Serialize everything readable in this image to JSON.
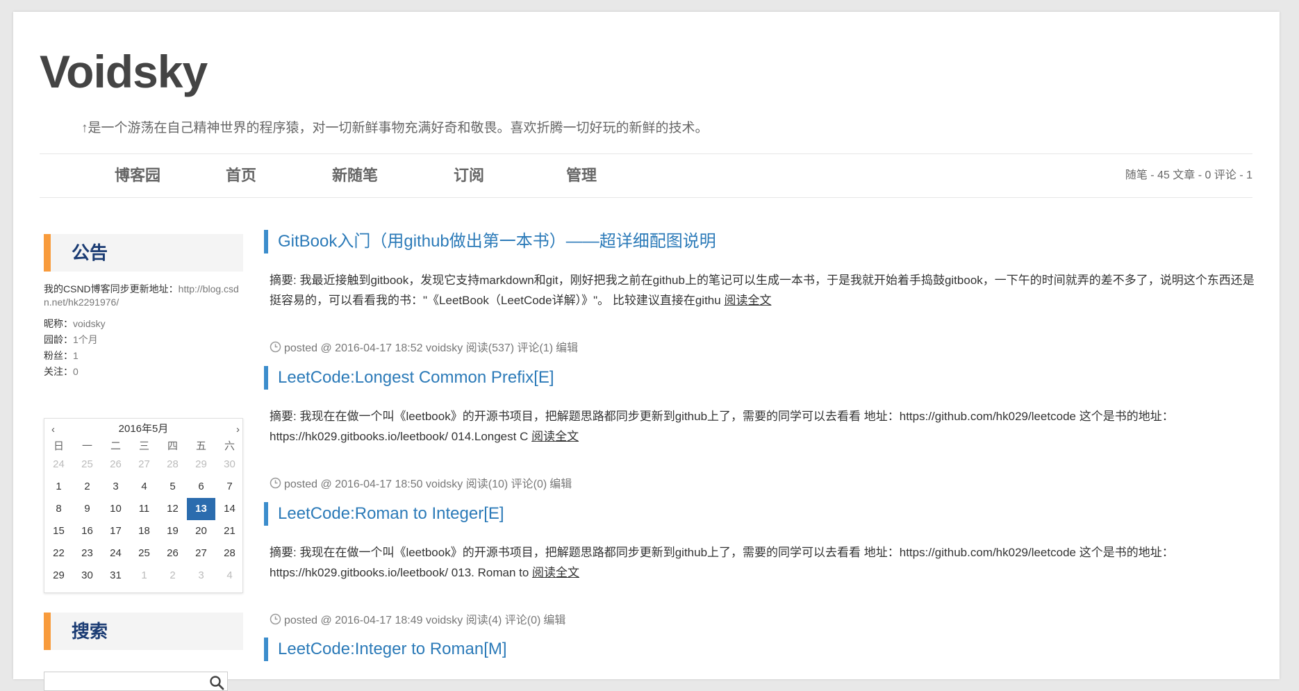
{
  "header": {
    "title": "Voidsky",
    "description": "↑是一个游荡在自己精神世界的程序猿，对一切新鲜事物充满好奇和敬畏。喜欢折腾一切好玩的新鲜的技术。"
  },
  "nav": {
    "items": [
      "博客园",
      "首页",
      "新随笔",
      "订阅",
      "管理"
    ],
    "stats": "随笔 - 45  文章 - 0  评论 - 1"
  },
  "sidebar": {
    "notice_title": "公告",
    "notice_text": "我的CSND博客同步更新地址：",
    "notice_link": "http://blog.csdn.net/hk2291976/",
    "profile": [
      {
        "label": "昵称：",
        "value": "voidsky"
      },
      {
        "label": "园龄：",
        "value": "1个月"
      },
      {
        "label": "粉丝：",
        "value": "1"
      },
      {
        "label": "关注：",
        "value": "0"
      }
    ],
    "calendar": {
      "title": "2016年5月",
      "prev": "‹",
      "next": "›",
      "weekdays": [
        "日",
        "一",
        "二",
        "三",
        "四",
        "五",
        "六"
      ],
      "today": "13",
      "weeks": [
        [
          "24",
          "25",
          "26",
          "27",
          "28",
          "29",
          "30"
        ],
        [
          "1",
          "2",
          "3",
          "4",
          "5",
          "6",
          "7"
        ],
        [
          "8",
          "9",
          "10",
          "11",
          "12",
          "13",
          "14"
        ],
        [
          "15",
          "16",
          "17",
          "18",
          "19",
          "20",
          "21"
        ],
        [
          "22",
          "23",
          "24",
          "25",
          "26",
          "27",
          "28"
        ],
        [
          "29",
          "30",
          "31",
          "1",
          "2",
          "3",
          "4"
        ]
      ]
    },
    "search_title": "搜索",
    "search_placeholder": ""
  },
  "posts": [
    {
      "title": "GitBook入门（用github做出第一本书）——超详细配图说明",
      "abstract": "摘要: 我最近接触到gitbook，发现它支持markdown和git，刚好把我之前在github上的笔记可以生成一本书，于是我就开始着手捣鼓gitbook，一下午的时间就弄的差不多了，说明这个东西还是挺容易的，可以看看我的书：\"《LeetBook（LeetCode详解）》\"。 比较建议直接在githu ",
      "read_more": "阅读全文",
      "meta": "posted @ 2016-04-17 18:52 voidsky 阅读(537) 评论(1)",
      "edit": "编辑"
    },
    {
      "title": "LeetCode:Longest Common Prefix[E]",
      "abstract": "摘要: 我现在在做一个叫《leetbook》的开源书项目，把解题思路都同步更新到github上了，需要的同学可以去看看 地址：https://github.com/hk029/leetcode 这个是书的地址：https://hk029.gitbooks.io/leetbook/ 014.Longest C ",
      "read_more": "阅读全文",
      "meta": "posted @ 2016-04-17 18:50 voidsky 阅读(10) 评论(0)",
      "edit": "编辑"
    },
    {
      "title": "LeetCode:Roman to Integer[E]",
      "abstract": "摘要: 我现在在做一个叫《leetbook》的开源书项目，把解题思路都同步更新到github上了，需要的同学可以去看看 地址：https://github.com/hk029/leetcode 这个是书的地址：https://hk029.gitbooks.io/leetbook/ 013. Roman to ",
      "read_more": "阅读全文",
      "meta": "posted @ 2016-04-17 18:49 voidsky 阅读(4) 评论(0)",
      "edit": "编辑"
    },
    {
      "title": "LeetCode:Integer to Roman[M]"
    }
  ]
}
